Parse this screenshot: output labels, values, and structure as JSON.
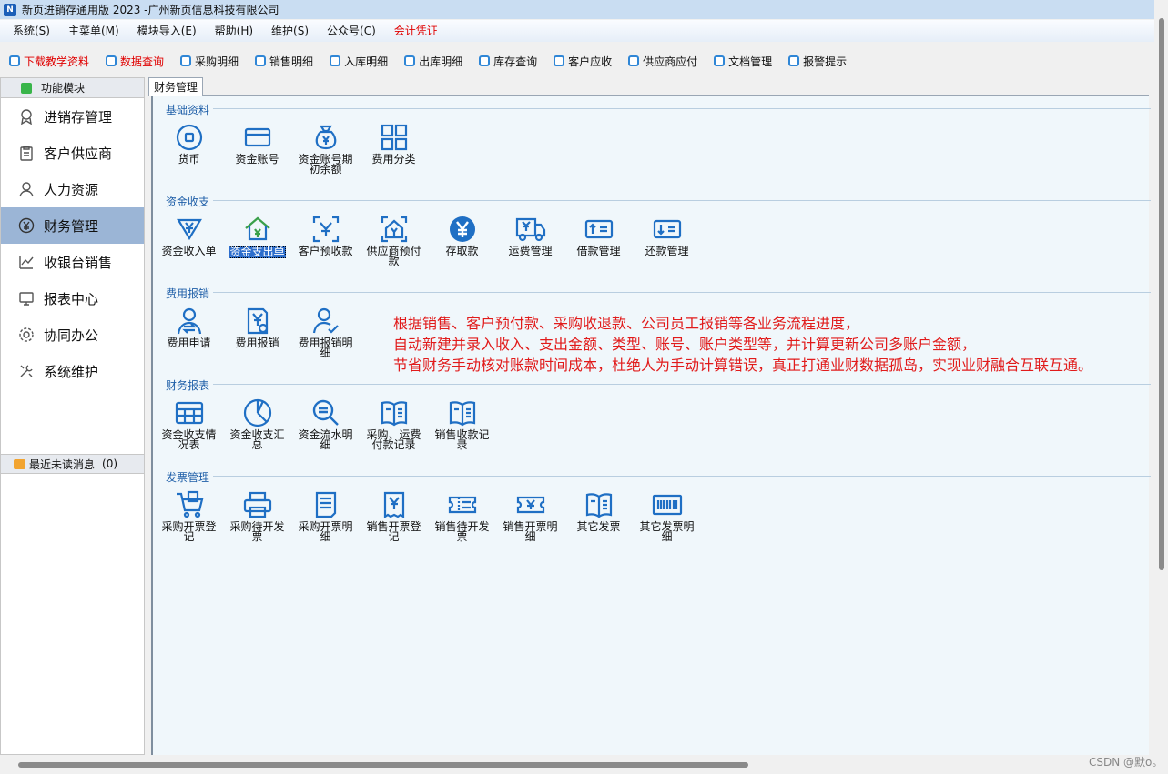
{
  "title": "新页进销存通用版 2023 -广州新页信息科技有限公司",
  "menus": [
    "系统(S)",
    "主菜单(M)",
    "模块导入(E)",
    "帮助(H)",
    "维护(S)",
    "公众号(C)",
    "会计凭证"
  ],
  "toolbar": [
    "下载教学资料",
    "数据查询",
    "采购明细",
    "销售明细",
    "入库明细",
    "出库明细",
    "库存查询",
    "客户应收",
    "供应商应付",
    "文档管理",
    "报警提示"
  ],
  "sidebar": {
    "header": "功能模块",
    "items": [
      "进销存管理",
      "客户供应商",
      "人力资源",
      "财务管理",
      "收银台销售",
      "报表中心",
      "协同办公",
      "系统维护"
    ],
    "selected": "财务管理",
    "messages": "最近未读消息",
    "message_count": "(0)"
  },
  "tab": "财务管理",
  "groups": [
    {
      "title": "基础资料",
      "items": [
        "货币",
        "资金账号",
        "资金账号期初余额",
        "费用分类"
      ]
    },
    {
      "title": "资金收支",
      "items": [
        "资金收入单",
        "资金支出单",
        "客户预收款",
        "供应商预付款",
        "存取款",
        "运费管理",
        "借款管理",
        "还款管理"
      ]
    },
    {
      "title": "费用报销",
      "items": [
        "费用申请",
        "费用报销",
        "费用报销明细"
      ]
    },
    {
      "title": "财务报表",
      "items": [
        "资金收支情况表",
        "资金收支汇总",
        "资金流水明细",
        "采购、运费付款记录",
        "销售收款记录"
      ]
    },
    {
      "title": "发票管理",
      "items": [
        "采购开票登记",
        "采购待开发票",
        "采购开票明细",
        "销售开票登记",
        "销售待开发票",
        "销售开票明细",
        "其它发票",
        "其它发票明细"
      ]
    }
  ],
  "selected_item": "资金支出单",
  "note": [
    "根据销售、客户预付款、采购收退款、公司员工报销等各业务流程进度，",
    "自动新建并录入收入、支出金额、类型、账号、账户类型等，并计算更新公司多账户金额，",
    "节省财务手动核对账款时间成本，杜绝人为手动计算错误，真正打通业财数据孤岛，实现业财融合互联互通。"
  ],
  "watermark": "CSDN @默o。",
  "colors": {
    "icon": "#1f6fc4",
    "accent_red": "#e00000",
    "selected_side": "#9bb5d6",
    "content_bg": "#f0f7fb"
  }
}
